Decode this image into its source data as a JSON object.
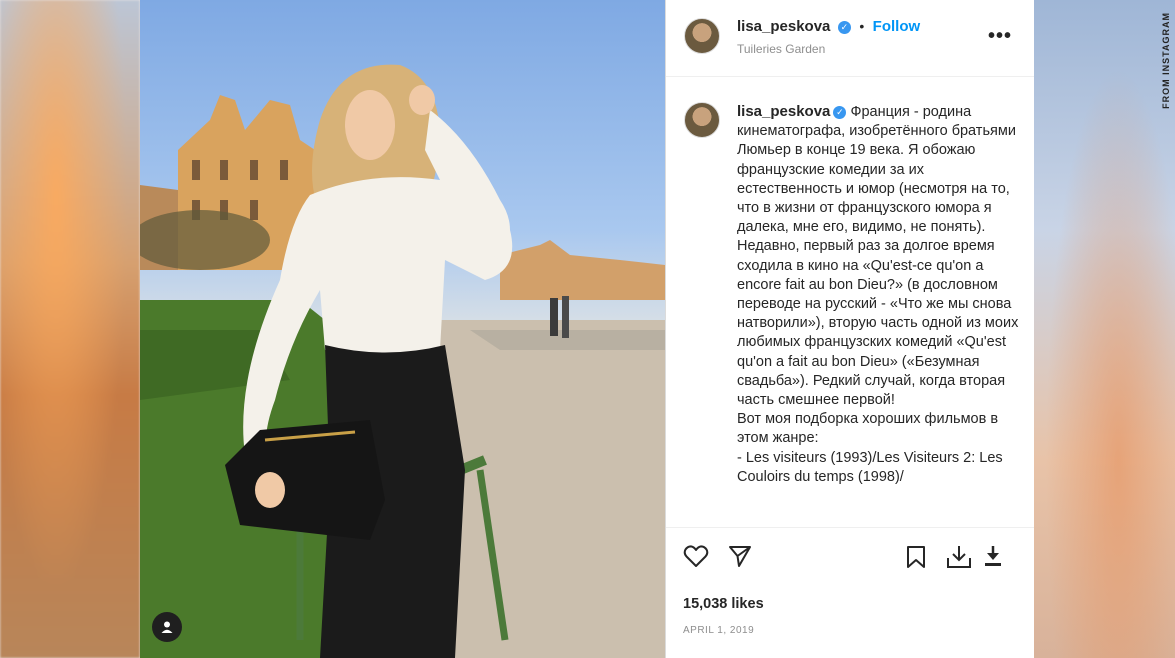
{
  "credit": "FROM INSTAGRAM",
  "post": {
    "username": "lisa_peskova",
    "location": "Tuileries Garden",
    "follow_label": "Follow",
    "separator": "•",
    "more_label": "•••",
    "caption": "Франция - родина кинематографа, изобретённого братьями Люмьер в конце 19 века. Я обожаю французские комедии за их естественность и юмор (несмотря на то, что в жизни от французского юмора я далека, мне его, видимо, не понять). Недавно, первый раз за долгое время сходила в кино на «Qu'est-ce qu'on a encore fait au bon Dieu?» (в дословном переводе на русский - «Что же мы снова натворили»), вторую часть одной из моих любимых французских комедий «Qu'est qu'on a fait au bon Dieu» («Безумная свадьба»). Редкий случай, когда вторая часть смешнее первой!\nВот моя подборка хороших фильмов в этом жанре:\n- Les visiteurs (1993)/Les Visiteurs 2: Les Couloirs du temps (1998)/",
    "likes": "15,038 likes",
    "date": "APRIL 1, 2019"
  },
  "icons": {
    "verified": "verified-badge-icon",
    "like": "heart-icon",
    "share": "paper-plane-icon",
    "save": "bookmark-icon",
    "download": "download-icon",
    "download_alt": "download-arrow-icon",
    "user_tag": "user-icon"
  },
  "colors": {
    "link": "#0095f6",
    "verified": "#3897f0",
    "text": "#262626",
    "muted": "#8e8e8e"
  }
}
